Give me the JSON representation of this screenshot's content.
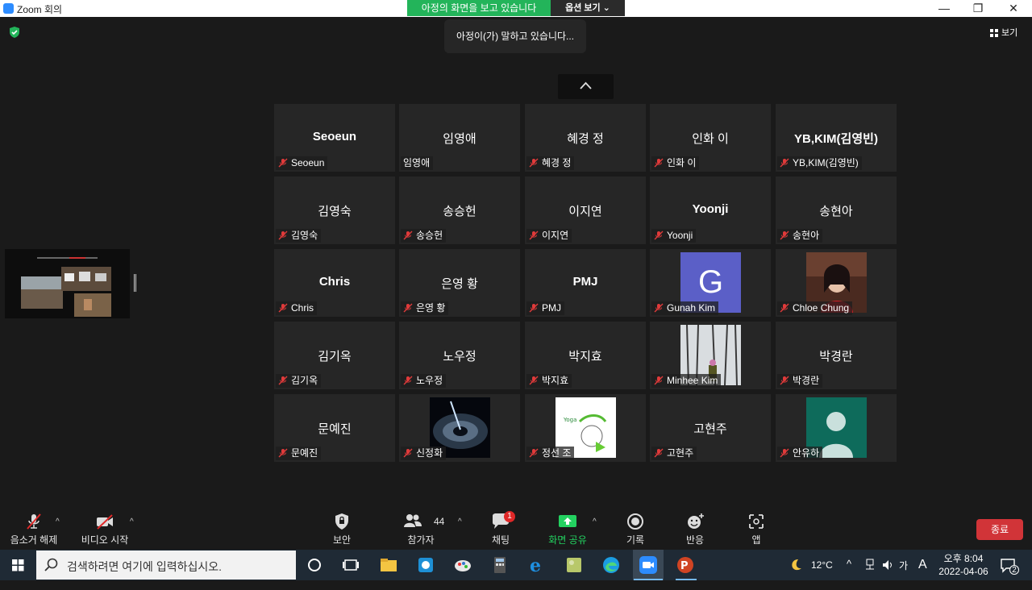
{
  "window": {
    "title": "Zoom 회의"
  },
  "banner": {
    "viewing_text": "아정의 화면을 보고 있습니다",
    "view_options": "옵션 보기 ⌄"
  },
  "toast": {
    "speaking": "아정이(가) 말하고 있습니다..."
  },
  "view_button": {
    "label": "보기"
  },
  "participants": [
    {
      "big": "Seoeun",
      "label": "Seoeun",
      "muted": true,
      "kr": false
    },
    {
      "big": "임영애",
      "label": "임영애",
      "muted": false,
      "kr": true
    },
    {
      "big": "혜경 정",
      "label": "혜경 정",
      "muted": true,
      "kr": true
    },
    {
      "big": "인화 이",
      "label": "인화 이",
      "muted": true,
      "kr": true
    },
    {
      "big": "YB,KIM(김영빈)",
      "label": "YB,KIM(김영빈)",
      "muted": true,
      "kr": false
    },
    {
      "big": "김영숙",
      "label": "김영숙",
      "muted": true,
      "kr": true
    },
    {
      "big": "송승헌",
      "label": "송승헌",
      "muted": true,
      "kr": true
    },
    {
      "big": "이지연",
      "label": "이지연",
      "muted": true,
      "kr": true
    },
    {
      "big": "Yoonji",
      "label": "Yoonji",
      "muted": true,
      "kr": false
    },
    {
      "big": "송현아",
      "label": "송현아",
      "muted": true,
      "kr": true
    },
    {
      "big": "Chris",
      "label": "Chris",
      "muted": true,
      "kr": false
    },
    {
      "big": "은영 황",
      "label": "은영 황",
      "muted": true,
      "kr": true
    },
    {
      "big": "PMJ",
      "label": "PMJ",
      "muted": true,
      "kr": false
    },
    {
      "big": "",
      "label": "Gunah Kim",
      "muted": true,
      "kr": false,
      "avatar": "G"
    },
    {
      "big": "",
      "label": "Chloe Chung",
      "muted": true,
      "kr": false,
      "photo": "portrait"
    },
    {
      "big": "김기옥",
      "label": "김기옥",
      "muted": true,
      "kr": true
    },
    {
      "big": "노우정",
      "label": "노우정",
      "muted": true,
      "kr": true
    },
    {
      "big": "박지효",
      "label": "박지효",
      "muted": true,
      "kr": true
    },
    {
      "big": "",
      "label": "Minhee Kim",
      "muted": true,
      "kr": false,
      "photo": "snow"
    },
    {
      "big": "박경란",
      "label": "박경란",
      "muted": true,
      "kr": true
    },
    {
      "big": "문예진",
      "label": "문예진",
      "muted": true,
      "kr": true
    },
    {
      "big": "",
      "label": "신정화",
      "muted": true,
      "kr": true,
      "photo": "galaxy"
    },
    {
      "big": "",
      "label": "정선 조",
      "muted": true,
      "kr": true,
      "photo": "cartoon"
    },
    {
      "big": "고현주",
      "label": "고현주",
      "muted": true,
      "kr": true
    },
    {
      "big": "",
      "label": "안유하",
      "muted": true,
      "kr": true,
      "photo": "silhouette"
    }
  ],
  "toolbar": {
    "unmute": "음소거 해제",
    "start_video": "비디오 시작",
    "security": "보안",
    "participants": "참가자",
    "participant_count": "44",
    "chat": "채팅",
    "chat_badge": "1",
    "share_screen": "화면 공유",
    "record": "기록",
    "reactions": "반응",
    "apps": "앱",
    "end": "종료"
  },
  "taskbar": {
    "search_placeholder": "검색하려면 여기에 입력하십시오.",
    "weather": "12°C",
    "ime": "A",
    "time": "오후 8:04",
    "date": "2022-04-06",
    "notif_count": "2"
  },
  "colors": {
    "share_green": "#23d160",
    "end_red": "#d13438",
    "banner_green": "#23b45a",
    "avatar_purple": "#5b5fc7"
  }
}
